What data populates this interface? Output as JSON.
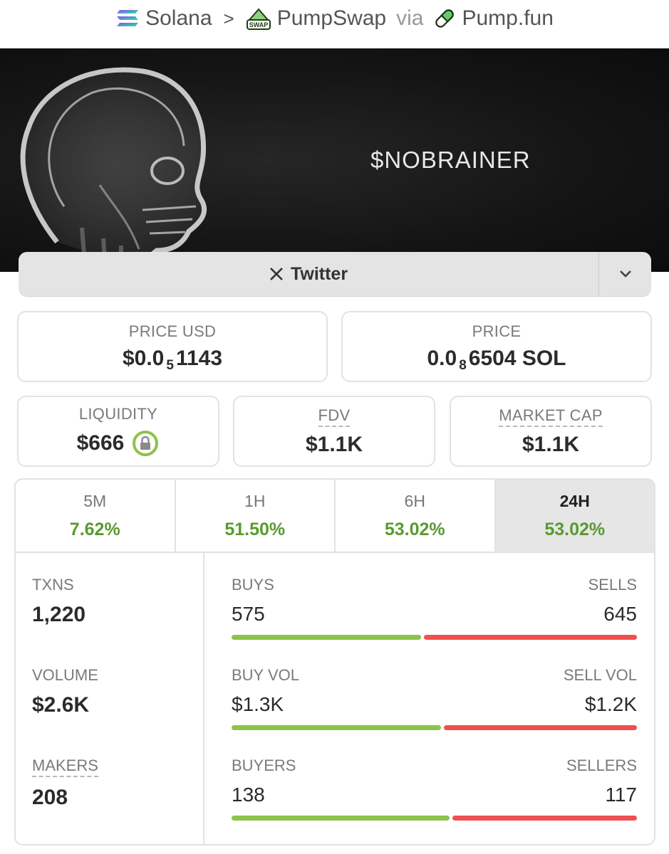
{
  "breadcrumb": {
    "chain": "Solana",
    "separator": ">",
    "dex": "PumpSwap",
    "dex_badge": "SWAP",
    "via": "via",
    "launchpad": "Pump.fun"
  },
  "banner": {
    "ticker": "$NOBRAINER"
  },
  "social": {
    "twitter_label": "Twitter"
  },
  "price_usd": {
    "label": "PRICE USD",
    "prefix": "$0.0",
    "zeros": "5",
    "digits": "1143"
  },
  "price_native": {
    "label": "PRICE",
    "prefix": "0.0",
    "zeros": "8",
    "digits": "6504 SOL"
  },
  "liquidity": {
    "label": "LIQUIDITY",
    "value": "$666"
  },
  "fdv": {
    "label": "FDV",
    "value": "$1.1K"
  },
  "market_cap": {
    "label": "MARKET CAP",
    "value": "$1.1K"
  },
  "timeframes": [
    {
      "label": "5M",
      "change": "7.62%"
    },
    {
      "label": "1H",
      "change": "51.50%"
    },
    {
      "label": "6H",
      "change": "53.02%"
    },
    {
      "label": "24H",
      "change": "53.02%",
      "active": true
    }
  ],
  "metrics": {
    "txns": {
      "label": "TXNS",
      "value": "1,220"
    },
    "volume": {
      "label": "VOLUME",
      "value": "$2.6K"
    },
    "makers": {
      "label": "MAKERS",
      "value": "208"
    }
  },
  "splits": {
    "txns": {
      "left_label": "BUYS",
      "right_label": "SELLS",
      "left_value": "575",
      "right_value": "645",
      "left_fraction": 0.4713
    },
    "volume": {
      "left_label": "BUY VOL",
      "right_label": "SELL VOL",
      "left_value": "$1.3K",
      "right_value": "$1.2K",
      "left_fraction": 0.52
    },
    "makers": {
      "left_label": "BUYERS",
      "right_label": "SELLERS",
      "left_value": "138",
      "right_value": "117",
      "left_fraction": 0.5412
    }
  },
  "colors": {
    "positive": "#5a9a2e",
    "buy_bar": "#8dc34a",
    "sell_bar": "#ef5050",
    "lock_ring": "#8dc34a"
  }
}
